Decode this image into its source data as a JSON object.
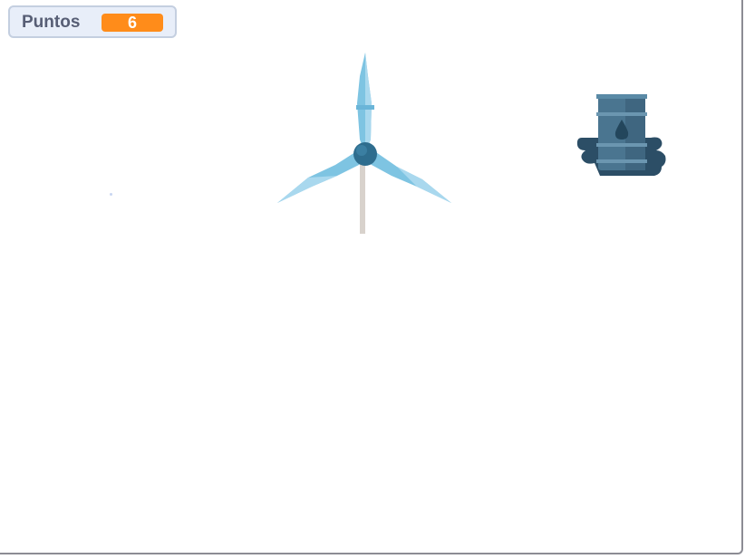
{
  "stage": {
    "background": "#ffffff"
  },
  "score_monitor": {
    "label": "Puntos",
    "value": "6",
    "value_color": "#ff8c1a"
  },
  "sprites": [
    {
      "name": "wind-turbine",
      "icon": "wind-turbine-icon",
      "colors": {
        "blade": "#7ec4e2",
        "hub": "#2e6d8e",
        "pole": "#d8d2cc"
      }
    },
    {
      "name": "oil-barrel",
      "icon": "oil-barrel-icon",
      "colors": {
        "body": "#4a7590",
        "base": "#2c4e66",
        "drop": "#23465c"
      }
    },
    {
      "name": "small-dot",
      "icon": "dot-icon",
      "colors": {
        "fill": "#c9d6f2"
      }
    }
  ]
}
